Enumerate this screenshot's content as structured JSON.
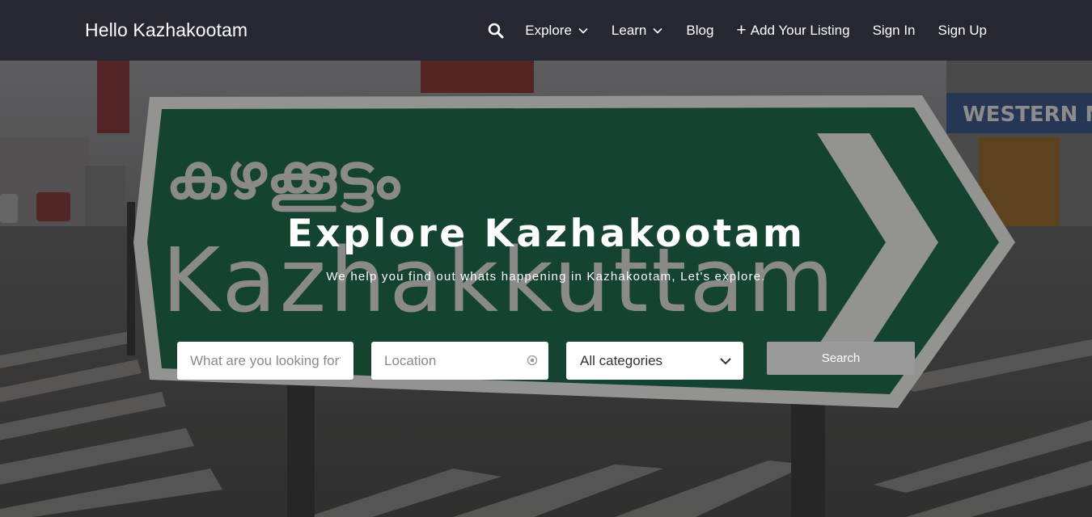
{
  "header": {
    "brand": "Hello Kazhakootam",
    "nav": {
      "explore": "Explore",
      "learn": "Learn",
      "blog": "Blog",
      "add_listing": "Add Your Listing",
      "sign_in": "Sign In",
      "sign_up": "Sign Up"
    },
    "icons": {
      "search": "search-icon",
      "dropdown": "chevron-down-icon",
      "add": "plus-icon"
    }
  },
  "hero": {
    "title": "Explore Kazhakootam",
    "subtitle": "We help you find out whats happening in Kazhakootam, Let's explore.",
    "sign_text_malayalam": "കഴക്കൂട്ടം",
    "sign_text_latin": "Kazhakkuttam",
    "shop_sign": "WESTERN M"
  },
  "search_form": {
    "what_placeholder": "What are you looking for?",
    "what_value": "",
    "location_placeholder": "Location",
    "location_value": "",
    "category_selected": "All categories",
    "submit_label": "Search"
  },
  "colors": {
    "topbar": "#262731",
    "sign_green": "#0f5f3b",
    "search_button": "#9a9a9a"
  }
}
